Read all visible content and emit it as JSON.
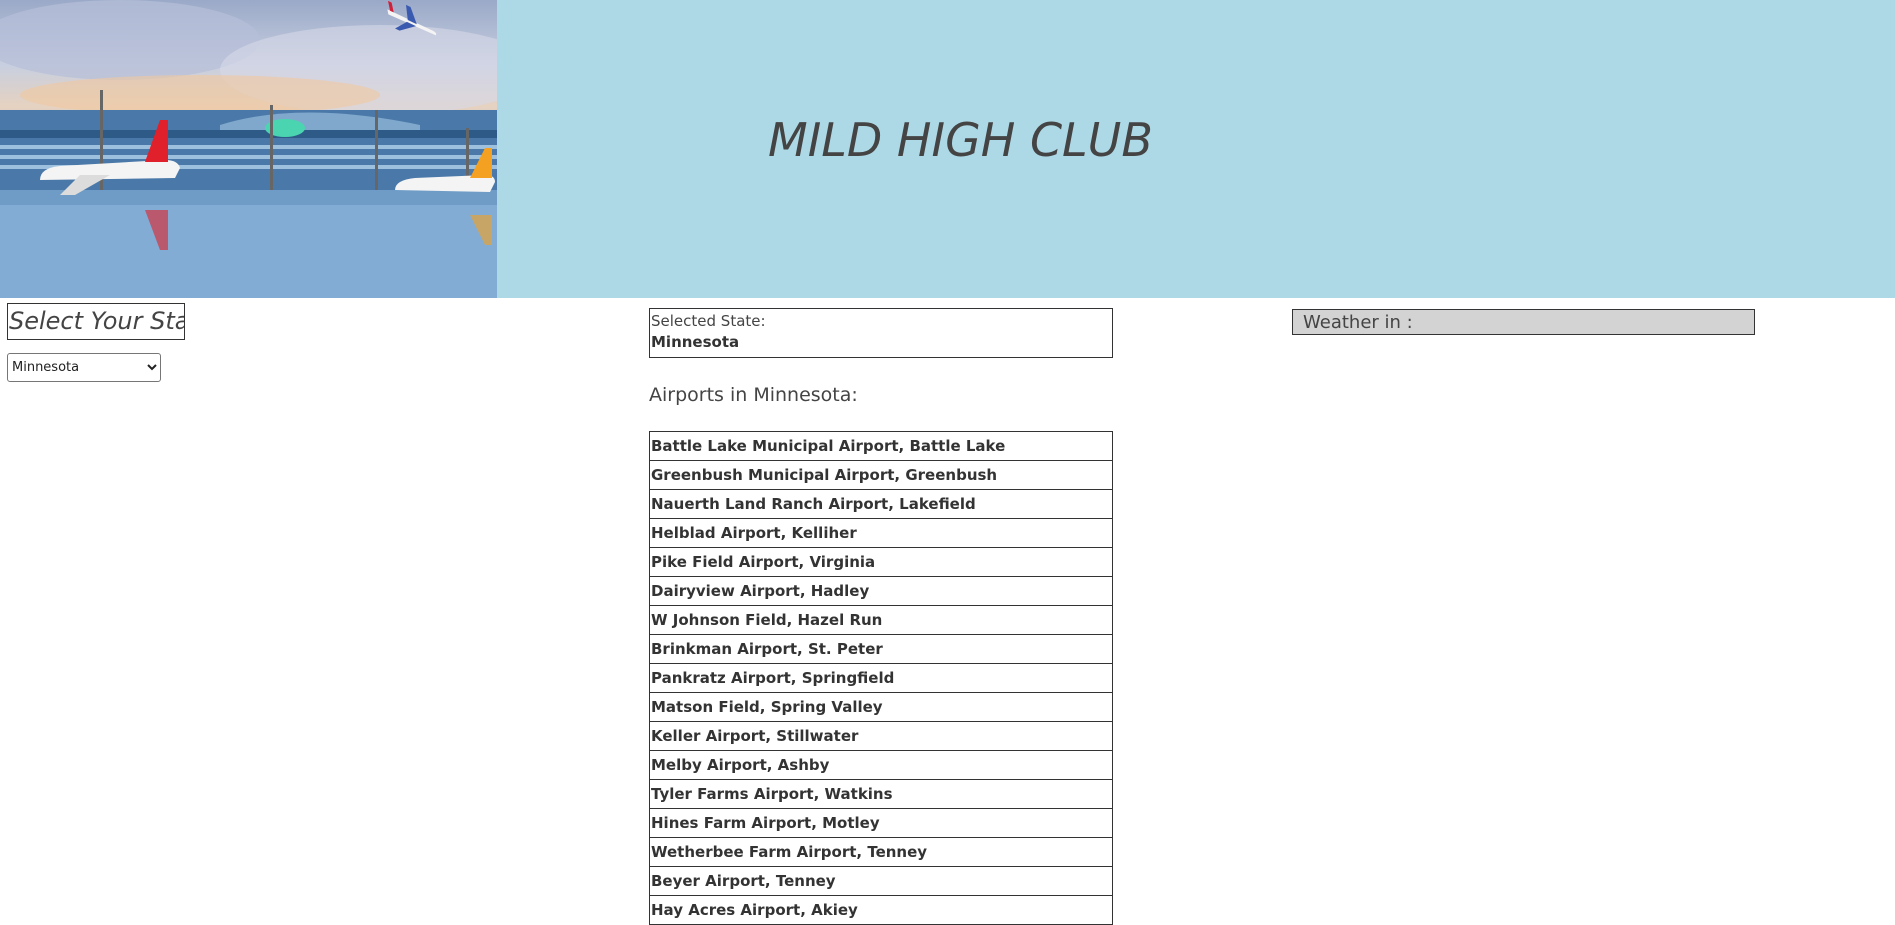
{
  "header": {
    "title": "MILD HIGH CLUB",
    "background_color": "#add8e6",
    "hero_image": "airport-terminal-photo"
  },
  "state_picker": {
    "heading": "Select Your State",
    "selected": "Minnesota",
    "options": [
      "Minnesota"
    ]
  },
  "selected_state": {
    "label": "Selected State:",
    "value": "Minnesota"
  },
  "airports": {
    "heading": "Airports in Minnesota:",
    "items": [
      "Battle Lake Municipal Airport, Battle Lake",
      "Greenbush Municipal Airport, Greenbush",
      "Nauerth Land Ranch Airport, Lakefield",
      "Helblad Airport, Kelliher",
      "Pike Field Airport, Virginia",
      "Dairyview Airport, Hadley",
      "W Johnson Field, Hazel Run",
      "Brinkman Airport, St. Peter",
      "Pankratz Airport, Springfield",
      "Matson Field, Spring Valley",
      "Keller Airport, Stillwater",
      "Melby Airport, Ashby",
      "Tyler Farms Airport, Watkins",
      "Hines Farm Airport, Motley",
      "Wetherbee Farm Airport, Tenney",
      "Beyer Airport, Tenney",
      "Hay Acres Airport, Akiey"
    ]
  },
  "weather": {
    "label": "Weather in :"
  }
}
